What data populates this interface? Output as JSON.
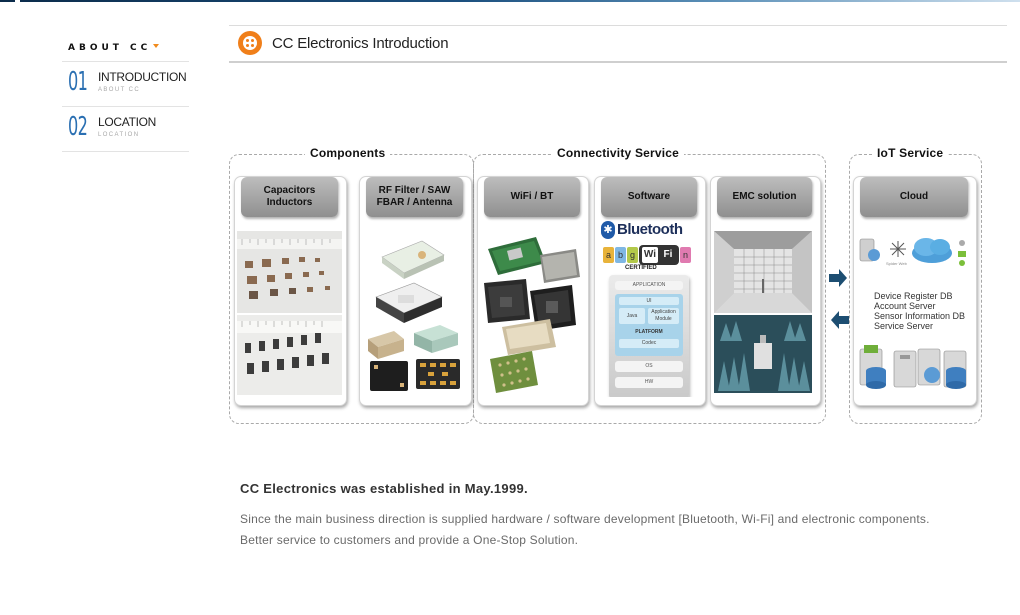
{
  "sidebar": {
    "title": "ABOUT CC",
    "items": [
      {
        "num": "01",
        "label": "INTRODUCTION",
        "sub": "ABOUT CC"
      },
      {
        "num": "02",
        "label": "LOCATION",
        "sub": "LOCATION"
      }
    ]
  },
  "header": {
    "title": "CC Electronics Introduction"
  },
  "diagram": {
    "groups": {
      "components": "Components",
      "connectivity": "Connectivity Service",
      "iot": "IoT Service"
    },
    "cards": {
      "capacitors": "Capacitors\nInductors",
      "rf": "RF Filter / SAW\nFBAR / Antenna",
      "wifi": "WiFi / BT",
      "software": "Software",
      "emc": "EMC solution",
      "cloud": "Cloud"
    },
    "software_stack": {
      "bluetooth": "Bluetooth",
      "wifi_letters": [
        "a",
        "b",
        "g",
        "Wi",
        "Fi",
        "n"
      ],
      "certified": "CERTIFIED",
      "application": "APPLICATION",
      "ui": "UI",
      "java": "Java",
      "app_module": "Application Module",
      "platform": "PLATFORM",
      "codec": "Codec",
      "os": "OS",
      "hw": "HW"
    },
    "cloud_list": [
      "Device Register DB",
      "Account Server",
      "Sensor Information DB",
      "Service Server"
    ],
    "cloud_small": [
      "Spider Web"
    ]
  },
  "intro": {
    "title": "CC Electronics was established in May.1999.",
    "line1": "Since the main business direction is supplied hardware / software development [Bluetooth, Wi-Fi]  and electronic components.",
    "line2": "Better service to customers and provide a One-Stop Solution."
  },
  "colors": {
    "accent": "#f07f1a",
    "blue_num": "#2a6fb2",
    "arrow": "#1d4e72"
  }
}
